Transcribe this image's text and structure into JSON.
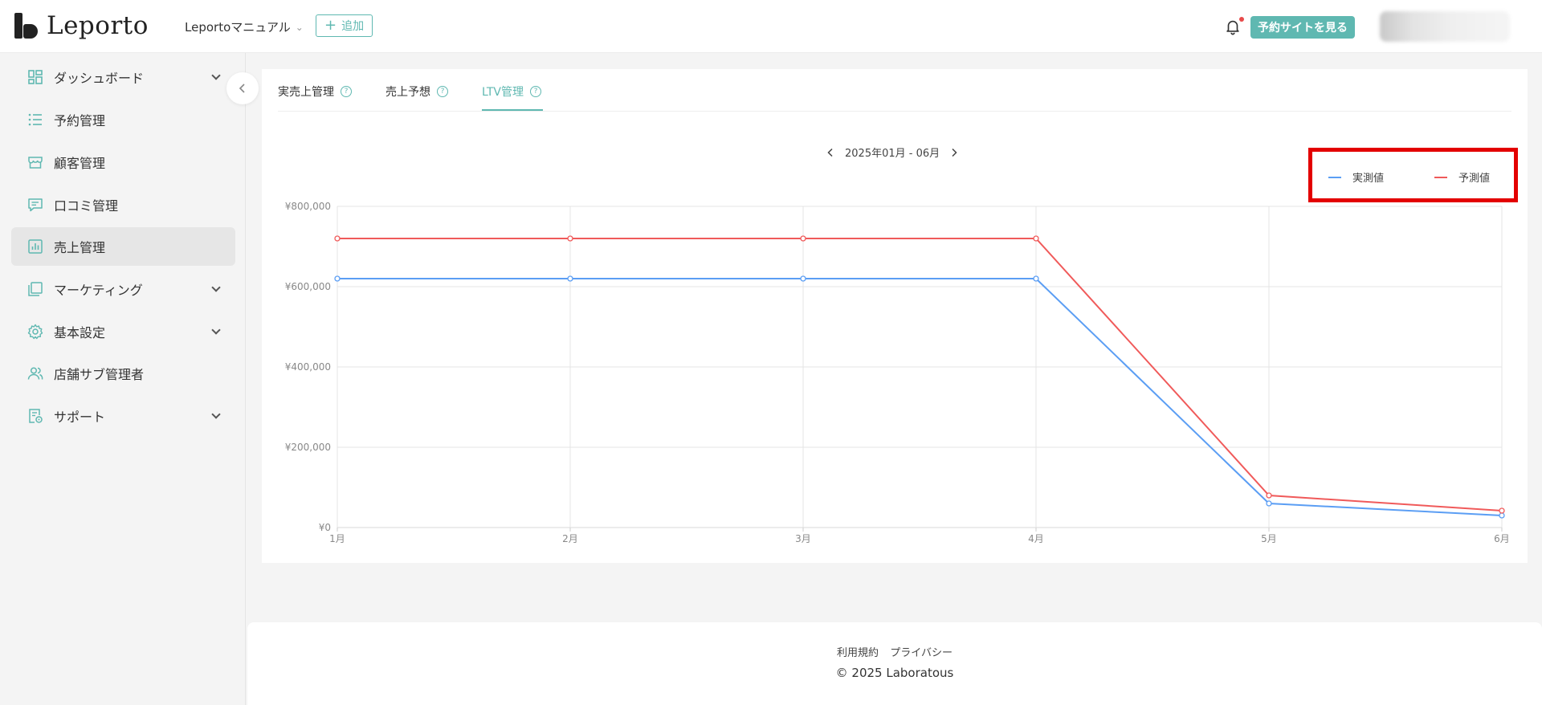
{
  "header": {
    "logo_text": "Leporto",
    "store_name": "Leportoマニュアル",
    "add_label": "追加",
    "view_site_label": "予約サイトを見る"
  },
  "sidebar": {
    "items": [
      {
        "label": "ダッシュボード",
        "icon": "dashboard-icon",
        "expandable": true
      },
      {
        "label": "予約管理",
        "icon": "list-icon",
        "expandable": false
      },
      {
        "label": "顧客管理",
        "icon": "store-icon",
        "expandable": false
      },
      {
        "label": "口コミ管理",
        "icon": "comment-icon",
        "expandable": false
      },
      {
        "label": "売上管理",
        "icon": "bar-chart-icon",
        "expandable": false,
        "active": true
      },
      {
        "label": "マーケティング",
        "icon": "copy-icon",
        "expandable": true
      },
      {
        "label": "基本設定",
        "icon": "gear-icon",
        "expandable": true
      },
      {
        "label": "店舗サブ管理者",
        "icon": "users-icon",
        "expandable": false
      },
      {
        "label": "サポート",
        "icon": "support-icon",
        "expandable": true
      }
    ]
  },
  "tabs": [
    {
      "label": "実売上管理",
      "active": false
    },
    {
      "label": "売上予想",
      "active": false
    },
    {
      "label": "LTV管理",
      "active": true
    }
  ],
  "period": {
    "label": "2025年01月 - 06月"
  },
  "chart_data": {
    "type": "line",
    "categories": [
      "1月",
      "2月",
      "3月",
      "4月",
      "5月",
      "6月"
    ],
    "series": [
      {
        "name": "実測値",
        "color": "#5b9ef4",
        "values": [
          620000,
          620000,
          620000,
          620000,
          60000,
          30000
        ]
      },
      {
        "name": "予測値",
        "color": "#f05a5a",
        "values": [
          720000,
          720000,
          720000,
          720000,
          80000,
          42000
        ]
      }
    ],
    "y_ticks": [
      "¥800,000",
      "¥600,000",
      "¥400,000",
      "¥200,000",
      "¥0"
    ],
    "y_tick_values": [
      800000,
      600000,
      400000,
      200000,
      0
    ],
    "ylim": [
      0,
      800000
    ],
    "grid": true,
    "legend_position": "top-right"
  },
  "footer": {
    "terms": "利用規約",
    "privacy": "プライバシー",
    "copyright": "© 2025 Laboratous"
  }
}
